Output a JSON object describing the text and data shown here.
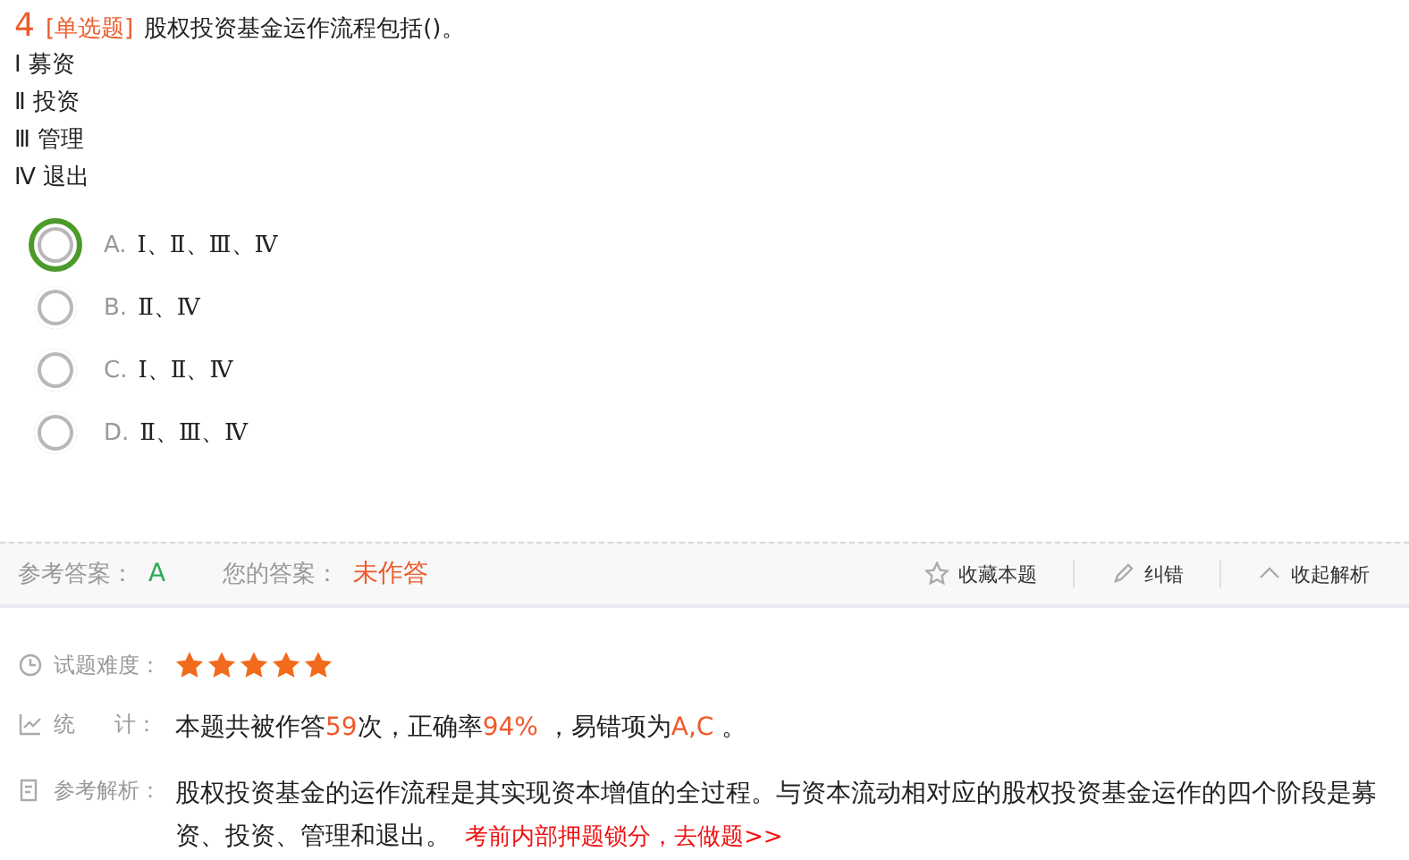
{
  "question": {
    "number": "4",
    "type_tag": "[单选题]",
    "stem": "股权投资基金运作流程包括()。",
    "statements": [
      "Ⅰ 募资",
      "Ⅱ 投资",
      "Ⅲ 管理",
      "Ⅳ 退出"
    ]
  },
  "options": [
    {
      "letter": "A.",
      "text": "Ⅰ、Ⅱ、Ⅲ、Ⅳ",
      "focused": true
    },
    {
      "letter": "B.",
      "text": "Ⅱ、Ⅳ",
      "focused": false
    },
    {
      "letter": "C.",
      "text": "Ⅰ、Ⅱ、Ⅳ",
      "focused": false
    },
    {
      "letter": "D.",
      "text": "Ⅱ、Ⅲ、Ⅳ",
      "focused": false
    }
  ],
  "answer_bar": {
    "reference_label": "参考答案：",
    "reference_value": "A",
    "your_label": "您的答案：",
    "your_value": "未作答",
    "actions": [
      {
        "kind": "star",
        "label": "收藏本题"
      },
      {
        "kind": "pencil",
        "label": "纠错"
      },
      {
        "kind": "collapse",
        "label": "收起解析"
      }
    ]
  },
  "analysis": {
    "difficulty_label": "试题难度：",
    "stars": 5,
    "stats_label": [
      "统",
      "计："
    ],
    "stats": [
      {
        "kind": "plain",
        "text": "本题共被作答"
      },
      {
        "kind": "accent",
        "text": "59"
      },
      {
        "kind": "plain",
        "text": "次，正确率"
      },
      {
        "kind": "accent",
        "text": "94%"
      },
      {
        "kind": "plain",
        "text": " ，易错项为"
      },
      {
        "kind": "accent",
        "text": "A,C"
      },
      {
        "kind": "plain",
        "text": " 。"
      }
    ],
    "explanation_label": "参考解析：",
    "explanation": "股权投资基金的运作流程是其实现资本增值的全过程。与资本流动相对应的股权投资基金运作的四个阶段是募资、投资、管理和退出。",
    "link": "考前内部押题锁分，去做题>>"
  }
}
